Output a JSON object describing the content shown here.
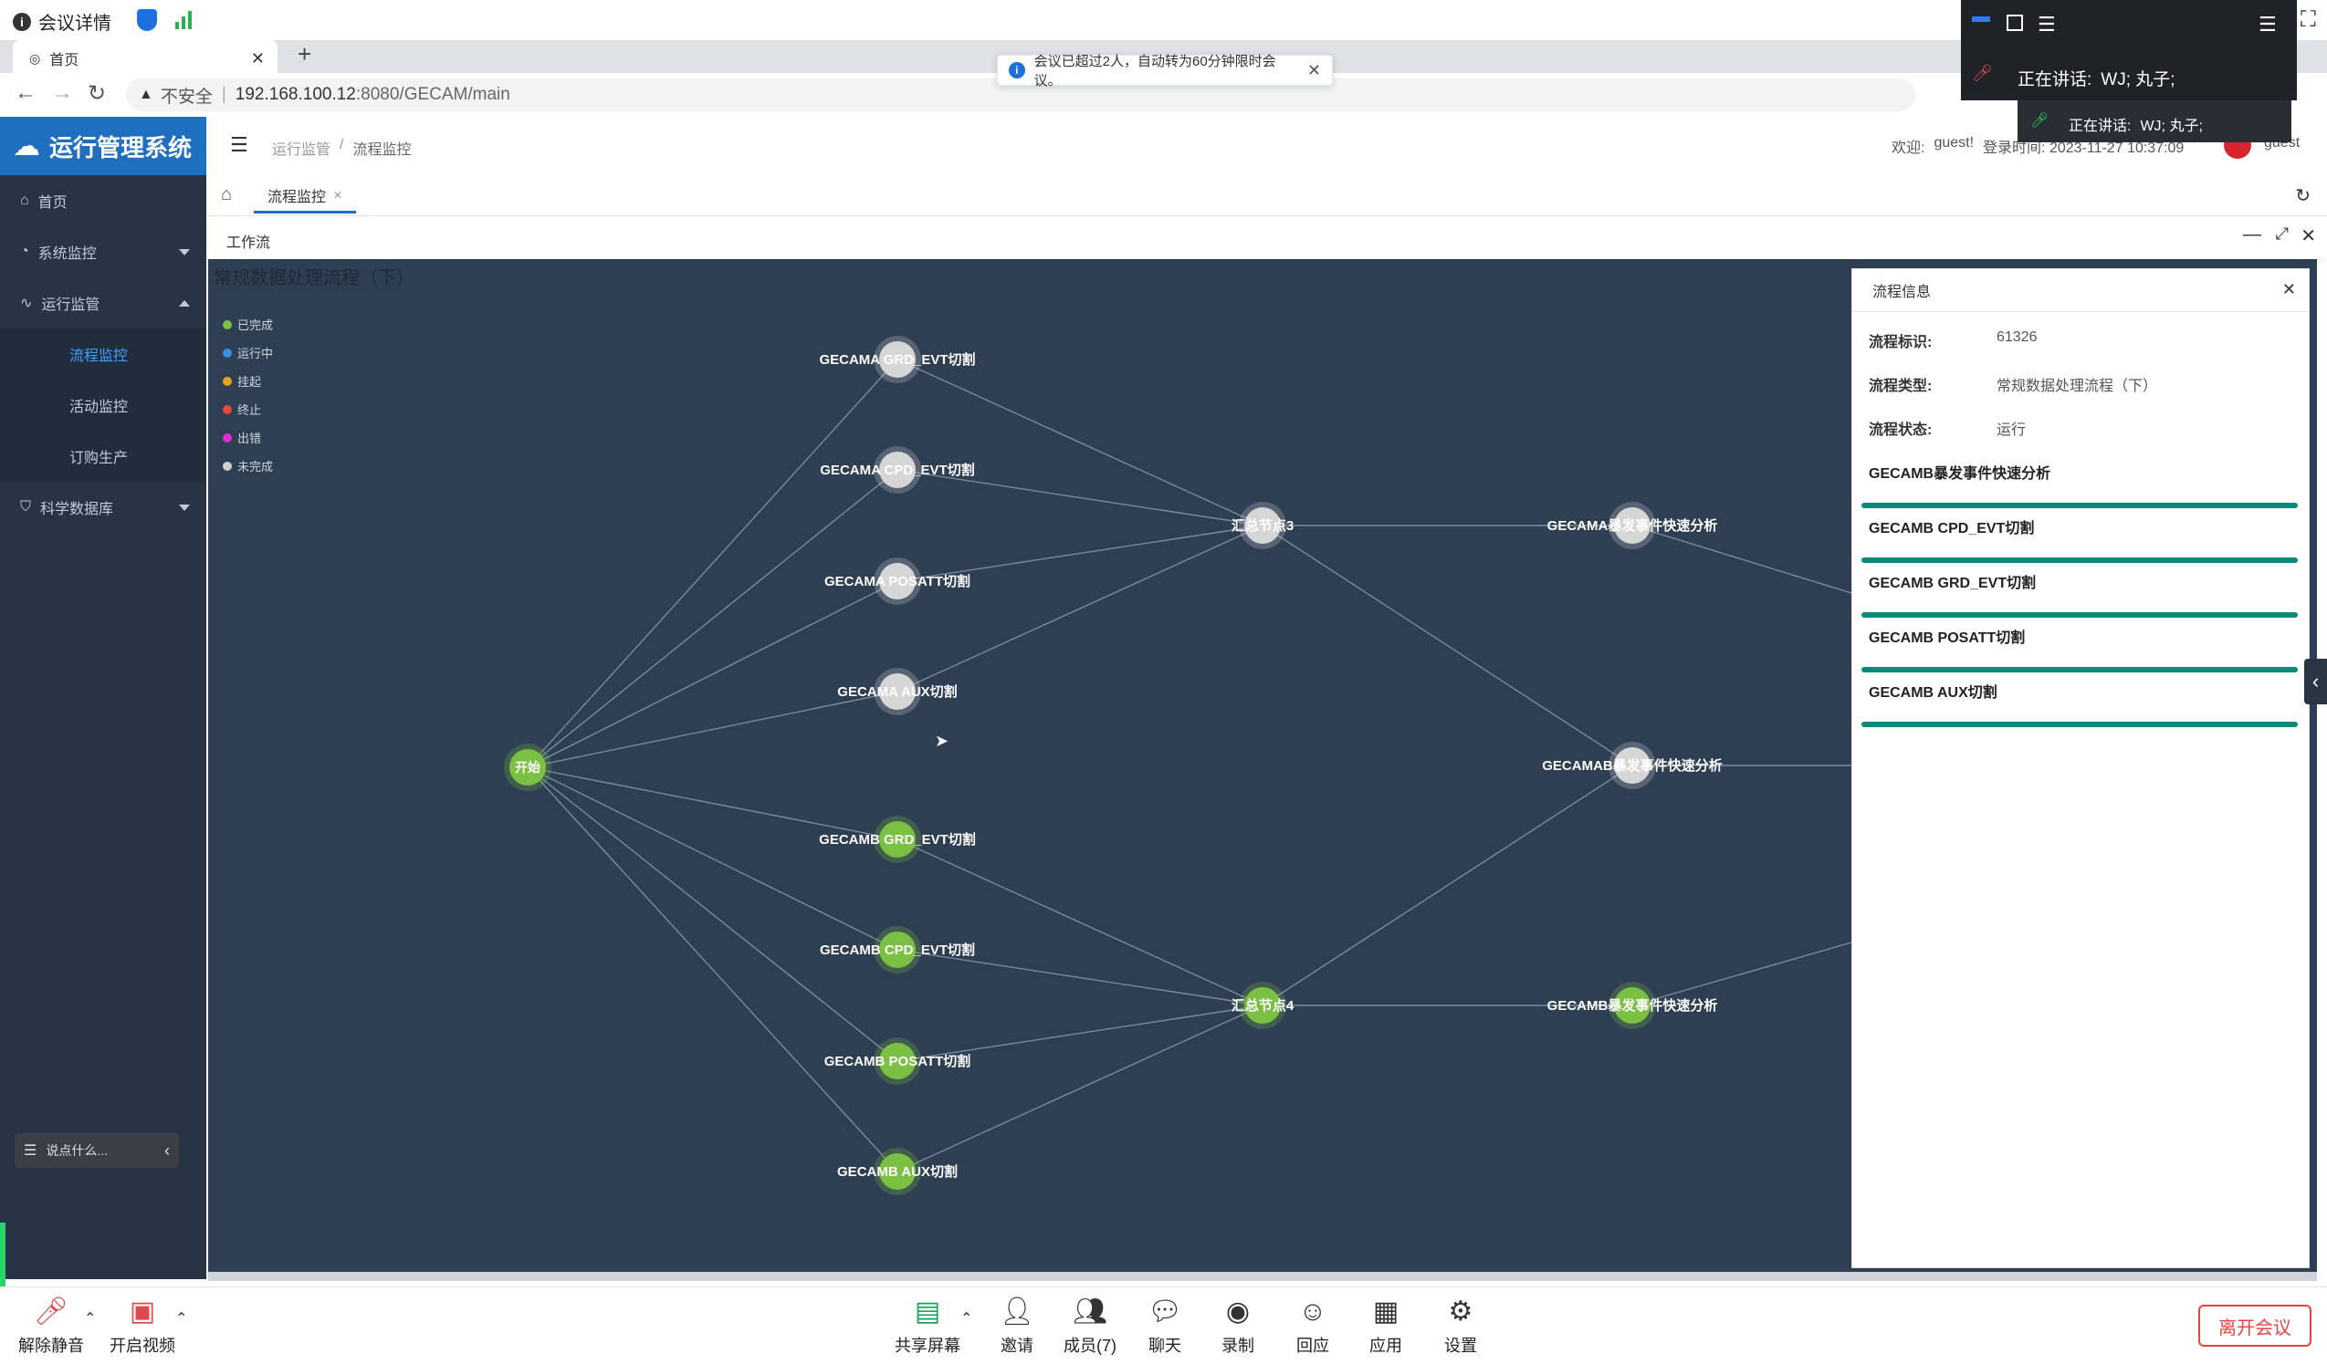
{
  "meeting": {
    "details_label": "会议详情",
    "toast_text": "会议已超过2人，自动转为60分钟限时会议。",
    "speaking_label": "正在讲话:",
    "speaking_names": "WJ; 丸子;",
    "speaking_label_small": "正在讲话:",
    "speaking_names_small": "WJ; 丸子;",
    "toolbar": {
      "unmute": "解除静音",
      "video": "开启视频",
      "share": "共享屏幕",
      "invite": "邀请",
      "members": "成员(7)",
      "chat": "聊天",
      "record": "录制",
      "reaction": "回应",
      "apps": "应用",
      "settings": "设置",
      "leave": "离开会议"
    },
    "chat_placeholder": "说点什么..."
  },
  "browser": {
    "tab_title": "首页",
    "insecure_label": "不安全",
    "url_host": "192.168.100.12",
    "url_rest": ":8080/GECAM/main"
  },
  "app": {
    "title": "运行管理系统",
    "breadcrumb": [
      "运行监管",
      "流程监控"
    ],
    "welcome": "欢迎:",
    "user": "guest!",
    "login_time": "登录时间: 2023-11-27 10:37:09",
    "user_short": "guest",
    "sidebar": {
      "home": "首页",
      "system_monitor": "系统监控",
      "ops_supervision": "运行监管",
      "sub_items": [
        "流程监控",
        "活动监控",
        "订购生产"
      ],
      "science_db": "科学数据库"
    },
    "page_tab": "流程监控",
    "panel_title": "工作流",
    "graph_title": "常规数据处理流程（下）",
    "legend": [
      {
        "label": "已完成",
        "color": "#7ac143"
      },
      {
        "label": "运行中",
        "color": "#3b8fe0"
      },
      {
        "label": "挂起",
        "color": "#e5a524"
      },
      {
        "label": "终止",
        "color": "#e5483d"
      },
      {
        "label": "出错",
        "color": "#e02bd0"
      },
      {
        "label": "未完成",
        "color": "#d0d0d0"
      }
    ],
    "nodes": {
      "start": "开始",
      "a1": "GECAMA GRD_EVT切割",
      "a2": "GECAMA CPD_EVT切割",
      "a3": "GECAMA POSATT切割",
      "a4": "GECAMA AUX切割",
      "b1": "GECAMB GRD_EVT切割",
      "b2": "GECAMB CPD_EVT切割",
      "b3": "GECAMB POSATT切割",
      "b4": "GECAMB AUX切割",
      "sum3": "汇总节点3",
      "sum4": "汇总节点4",
      "fa": "GECAMA暴发事件快速分析",
      "fab": "GECAMAB暴发事件快速分析",
      "fb": "GECAMB暴发事件快速分析"
    },
    "info": {
      "title": "流程信息",
      "id_label": "流程标识:",
      "id_value": "61326",
      "type_label": "流程类型:",
      "type_value": "常规数据处理流程（下）",
      "status_label": "流程状态:",
      "status_value": "运行",
      "activities": [
        "GECAMB暴发事件快速分析",
        "GECAMB CPD_EVT切割",
        "GECAMB GRD_EVT切割",
        "GECAMB POSATT切割",
        "GECAMB AUX切割"
      ]
    }
  }
}
